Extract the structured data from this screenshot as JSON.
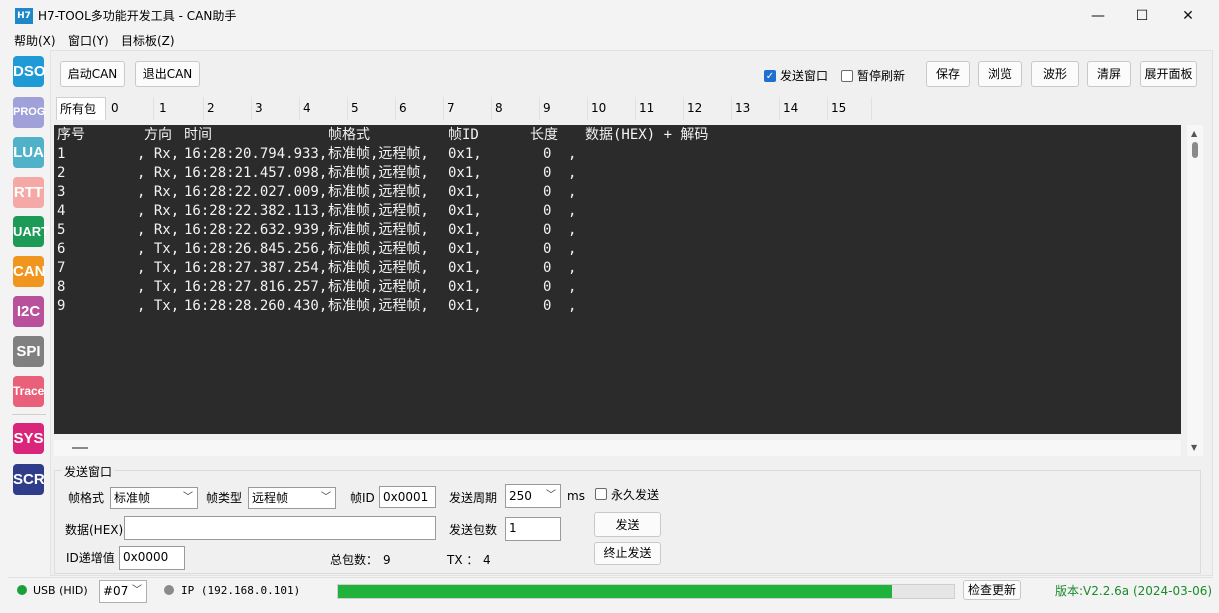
{
  "window": {
    "app_icon": "H7",
    "title": "H7-TOOL多功能开发工具 - CAN助手",
    "minimize": "—",
    "maximize": "☐",
    "close": "✕"
  },
  "menu": [
    "帮助(X)",
    "窗口(Y)",
    "目标板(Z)"
  ],
  "tools": [
    {
      "label": "DSO",
      "color": "#1e9ad6"
    },
    {
      "label": "PROG",
      "color": "#9fa1d8"
    },
    {
      "label": "LUA",
      "color": "#4fb2c9"
    },
    {
      "label": "RTT",
      "color": "#f4a9a6"
    },
    {
      "label": "UART",
      "color": "#1e9a57"
    },
    {
      "label": "CAN",
      "color": "#f0961e"
    },
    {
      "label": "I2C",
      "color": "#b8509c"
    },
    {
      "label": "SPI",
      "color": "#808080"
    },
    {
      "label": "Trace",
      "color": "#e8607a"
    },
    {
      "label": "SYS",
      "color": "#d9267b"
    },
    {
      "label": "SCR",
      "color": "#2e3c8a"
    }
  ],
  "toolbar": {
    "start_can": "启动CAN",
    "exit_can": "退出CAN",
    "send_window_check": "发送窗口",
    "send_window_checked": true,
    "pause_refresh_check": "暂停刷新",
    "pause_refresh_checked": false,
    "save": "保存",
    "browse": "浏览",
    "waveform": "波形",
    "clear": "清屏",
    "expand_panel": "展开面板"
  },
  "tabs": [
    "所有包",
    "0",
    "1",
    "2",
    "3",
    "4",
    "5",
    "6",
    "7",
    "8",
    "9",
    "10",
    "11",
    "12",
    "13",
    "14",
    "15"
  ],
  "console": {
    "header": {
      "seq": "序号",
      "dir": "方向",
      "time": "时间",
      "frame_fmt": "帧格式",
      "frame_id": "帧ID",
      "len": "长度",
      "data": "数据(HEX) + 解码"
    },
    "rows": [
      {
        "seq": "1",
        "dir": ", Rx,",
        "time": "16:28:20.794.933,",
        "frame": "标准帧,远程帧,",
        "id": "0x1,",
        "len": "0",
        "tail": ","
      },
      {
        "seq": "2",
        "dir": ", Rx,",
        "time": "16:28:21.457.098,",
        "frame": "标准帧,远程帧,",
        "id": "0x1,",
        "len": "0",
        "tail": ","
      },
      {
        "seq": "3",
        "dir": ", Rx,",
        "time": "16:28:22.027.009,",
        "frame": "标准帧,远程帧,",
        "id": "0x1,",
        "len": "0",
        "tail": ","
      },
      {
        "seq": "4",
        "dir": ", Rx,",
        "time": "16:28:22.382.113,",
        "frame": "标准帧,远程帧,",
        "id": "0x1,",
        "len": "0",
        "tail": ","
      },
      {
        "seq": "5",
        "dir": ", Rx,",
        "time": "16:28:22.632.939,",
        "frame": "标准帧,远程帧,",
        "id": "0x1,",
        "len": "0",
        "tail": ","
      },
      {
        "seq": "6",
        "dir": ", Tx,",
        "time": "16:28:26.845.256,",
        "frame": "标准帧,远程帧,",
        "id": "0x1,",
        "len": "0",
        "tail": ","
      },
      {
        "seq": "7",
        "dir": ", Tx,",
        "time": "16:28:27.387.254,",
        "frame": "标准帧,远程帧,",
        "id": "0x1,",
        "len": "0",
        "tail": ","
      },
      {
        "seq": "8",
        "dir": ", Tx,",
        "time": "16:28:27.816.257,",
        "frame": "标准帧,远程帧,",
        "id": "0x1,",
        "len": "0",
        "tail": ","
      },
      {
        "seq": "9",
        "dir": ", Tx,",
        "time": "16:28:28.260.430,",
        "frame": "标准帧,远程帧,",
        "id": "0x1,",
        "len": "0",
        "tail": ","
      }
    ]
  },
  "send": {
    "group_title": "发送窗口",
    "frame_format_label": "帧格式",
    "frame_format_value": "标准帧",
    "frame_type_label": "帧类型",
    "frame_type_value": "远程帧",
    "frame_id_label": "帧ID",
    "frame_id_value": "0x0001",
    "period_label": "发送周期",
    "period_value": "250",
    "period_unit": "ms",
    "forever_check": "永久发送",
    "forever_checked": false,
    "data_label": "数据(HEX)",
    "data_value": "",
    "count_label": "发送包数",
    "count_value": "1",
    "send_button": "发送",
    "stop_button": "终止发送",
    "id_inc_label": "ID递增值",
    "id_inc_value": "0x0000",
    "total_label": "总包数：",
    "total_value": "9",
    "tx_label": "TX ：",
    "tx_value": "4"
  },
  "status": {
    "usb": "USB (HID)",
    "usb_color": "#1aa03a",
    "device": "#07",
    "ip": "IP (192.168.0.101)",
    "ip_color": "#8a8a8a",
    "progress": 0.9,
    "progress_color": "#1fb33c",
    "check_update": "检查更新",
    "version": "版本:V2.2.6a (2024-03-06)",
    "version_color": "#1a8a2a"
  }
}
